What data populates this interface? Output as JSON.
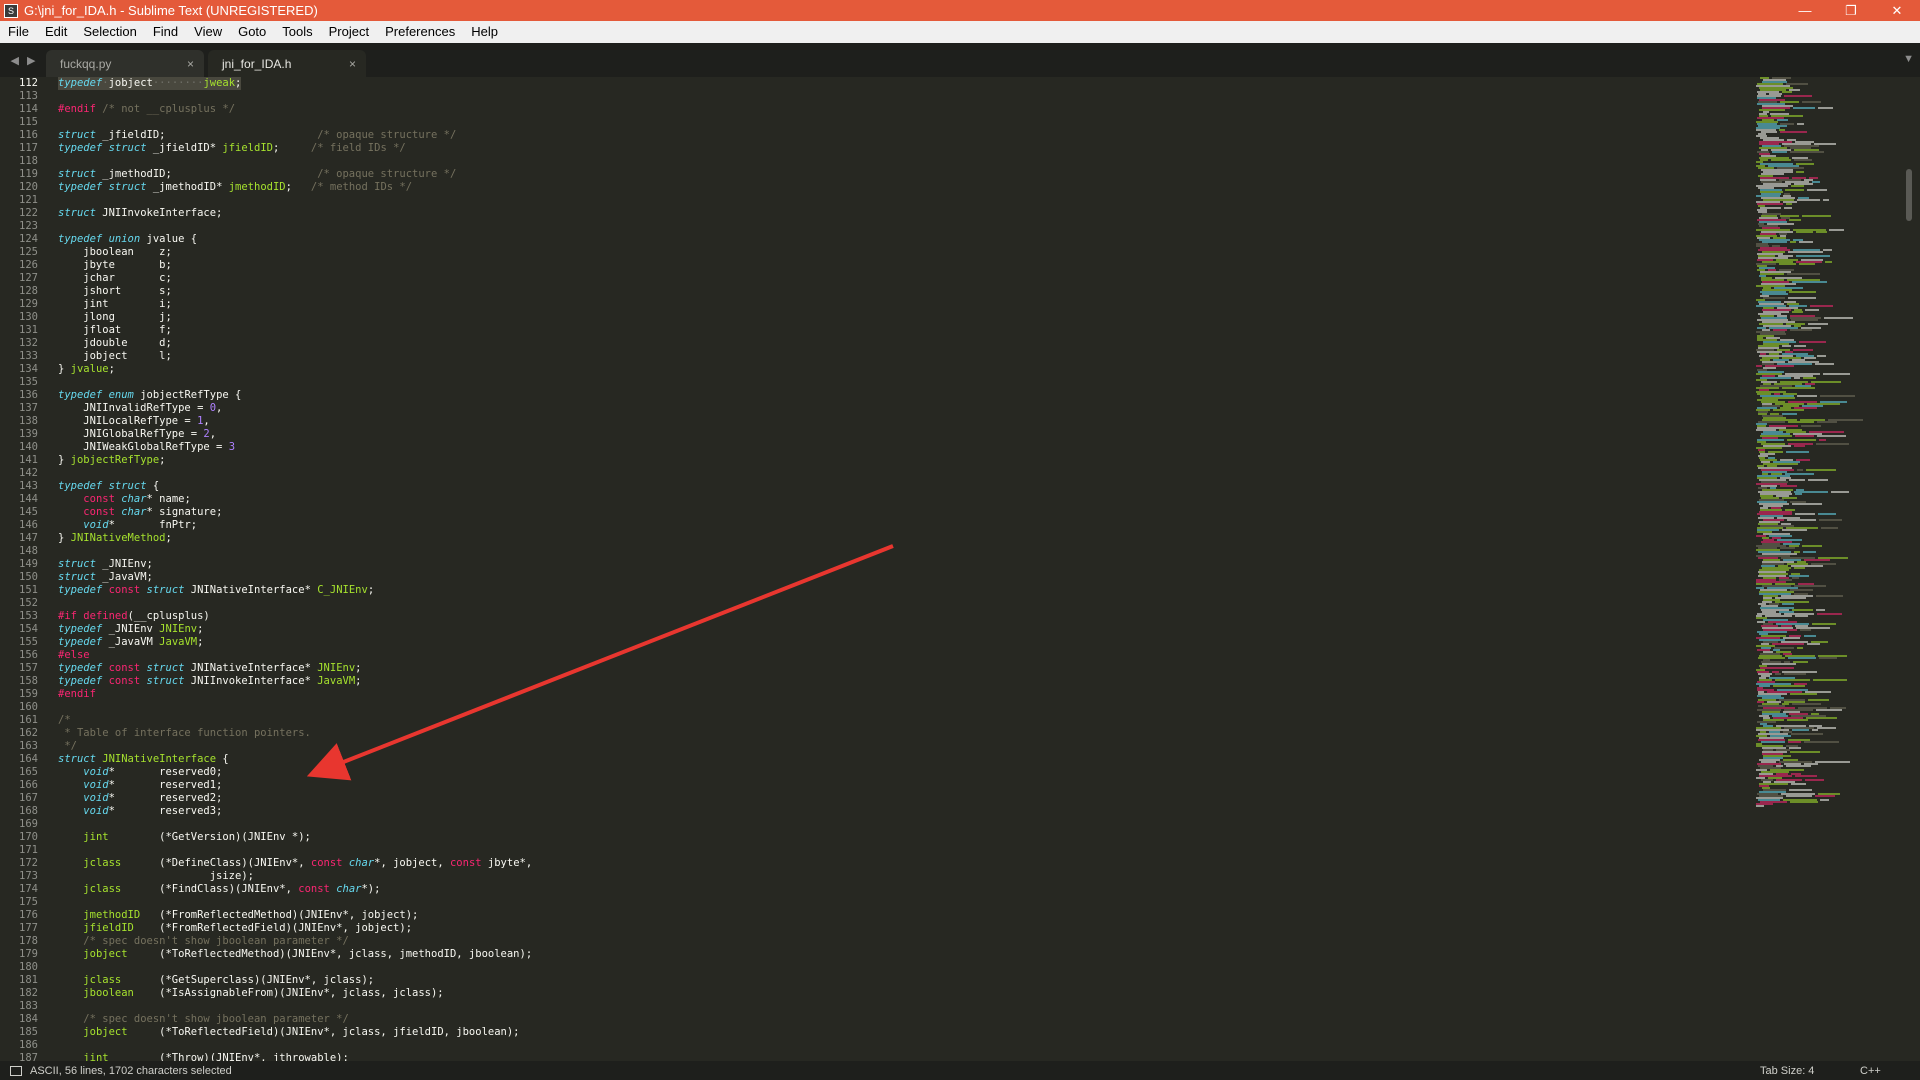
{
  "window": {
    "title": "G:\\jni_for_IDA.h - Sublime Text (UNREGISTERED)",
    "minimize": "—",
    "maximize": "❐",
    "close": "✕"
  },
  "menu": [
    "File",
    "Edit",
    "Selection",
    "Find",
    "View",
    "Goto",
    "Tools",
    "Project",
    "Preferences",
    "Help"
  ],
  "tabs": [
    {
      "label": "fuckqq.py",
      "close": "×",
      "active": false
    },
    {
      "label": "jni_for_IDA.h",
      "close": "×",
      "active": true
    }
  ],
  "nav": {
    "back": "◀",
    "forward": "▶",
    "dropdown": "▼"
  },
  "status": {
    "message": "ASCII, 56 lines, 1702 characters selected",
    "tab_size": "Tab Size: 4",
    "syntax": "C++"
  },
  "code": {
    "first_line": 112,
    "lines": [
      [
        [
          "kw",
          "typedef"
        ],
        [
          "dots",
          "·"
        ],
        [
          "t",
          "jobject"
        ],
        [
          "dots",
          "········"
        ],
        [
          "ty",
          "jweak"
        ],
        [
          "t",
          ";"
        ]
      ],
      [],
      [
        [
          "pp",
          "#endif"
        ],
        [
          "cm",
          " /* not __cplusplus */"
        ]
      ],
      [],
      [
        [
          "kw",
          "struct"
        ],
        [
          "t",
          " _jfieldID;                        "
        ],
        [
          "cm",
          "/* opaque structure */"
        ]
      ],
      [
        [
          "kw",
          "typedef"
        ],
        [
          "t",
          " "
        ],
        [
          "kw",
          "struct"
        ],
        [
          "t",
          " _jfieldID* "
        ],
        [
          "ty",
          "jfieldID"
        ],
        [
          "t",
          ";     "
        ],
        [
          "cm",
          "/* field IDs */"
        ]
      ],
      [],
      [
        [
          "kw",
          "struct"
        ],
        [
          "t",
          " _jmethodID;                       "
        ],
        [
          "cm",
          "/* opaque structure */"
        ]
      ],
      [
        [
          "kw",
          "typedef"
        ],
        [
          "t",
          " "
        ],
        [
          "kw",
          "struct"
        ],
        [
          "t",
          " _jmethodID* "
        ],
        [
          "ty",
          "jmethodID"
        ],
        [
          "t",
          ";   "
        ],
        [
          "cm",
          "/* method IDs */"
        ]
      ],
      [],
      [
        [
          "kw",
          "struct"
        ],
        [
          "t",
          " JNIInvokeInterface;"
        ]
      ],
      [],
      [
        [
          "kw",
          "typedef"
        ],
        [
          "t",
          " "
        ],
        [
          "kw",
          "union"
        ],
        [
          "t",
          " jvalue {"
        ]
      ],
      [
        [
          "t",
          "    jboolean    z;"
        ]
      ],
      [
        [
          "t",
          "    jbyte       b;"
        ]
      ],
      [
        [
          "t",
          "    jchar       c;"
        ]
      ],
      [
        [
          "t",
          "    jshort      s;"
        ]
      ],
      [
        [
          "t",
          "    jint        i;"
        ]
      ],
      [
        [
          "t",
          "    jlong       j;"
        ]
      ],
      [
        [
          "t",
          "    jfloat      f;"
        ]
      ],
      [
        [
          "t",
          "    jdouble     d;"
        ]
      ],
      [
        [
          "t",
          "    jobject     l;"
        ]
      ],
      [
        [
          "t",
          "} "
        ],
        [
          "ty",
          "jvalue"
        ],
        [
          "t",
          ";"
        ]
      ],
      [],
      [
        [
          "kw",
          "typedef"
        ],
        [
          "t",
          " "
        ],
        [
          "kw",
          "enum"
        ],
        [
          "t",
          " jobjectRefType {"
        ]
      ],
      [
        [
          "t",
          "    JNIInvalidRefType = "
        ],
        [
          "nm",
          "0"
        ],
        [
          "t",
          ","
        ]
      ],
      [
        [
          "t",
          "    JNILocalRefType = "
        ],
        [
          "nm",
          "1"
        ],
        [
          "t",
          ","
        ]
      ],
      [
        [
          "t",
          "    JNIGlobalRefType = "
        ],
        [
          "nm",
          "2"
        ],
        [
          "t",
          ","
        ]
      ],
      [
        [
          "t",
          "    JNIWeakGlobalRefType = "
        ],
        [
          "nm",
          "3"
        ]
      ],
      [
        [
          "t",
          "} "
        ],
        [
          "ty",
          "jobjectRefType"
        ],
        [
          "t",
          ";"
        ]
      ],
      [],
      [
        [
          "kw",
          "typedef"
        ],
        [
          "t",
          " "
        ],
        [
          "kw",
          "struct"
        ],
        [
          "t",
          " {"
        ]
      ],
      [
        [
          "t",
          "    "
        ],
        [
          "st",
          "const"
        ],
        [
          "t",
          " "
        ],
        [
          "kw",
          "char"
        ],
        [
          "t",
          "* name;"
        ]
      ],
      [
        [
          "t",
          "    "
        ],
        [
          "st",
          "const"
        ],
        [
          "t",
          " "
        ],
        [
          "kw",
          "char"
        ],
        [
          "t",
          "* signature;"
        ]
      ],
      [
        [
          "t",
          "    "
        ],
        [
          "kw",
          "void"
        ],
        [
          "t",
          "*       fnPtr;"
        ]
      ],
      [
        [
          "t",
          "} "
        ],
        [
          "ty",
          "JNINativeMethod"
        ],
        [
          "t",
          ";"
        ]
      ],
      [],
      [
        [
          "kw",
          "struct"
        ],
        [
          "t",
          " _JNIEnv;"
        ]
      ],
      [
        [
          "kw",
          "struct"
        ],
        [
          "t",
          " _JavaVM;"
        ]
      ],
      [
        [
          "kw",
          "typedef"
        ],
        [
          "t",
          " "
        ],
        [
          "st",
          "const"
        ],
        [
          "t",
          " "
        ],
        [
          "kw",
          "struct"
        ],
        [
          "t",
          " JNINativeInterface* "
        ],
        [
          "ty",
          "C_JNIEnv"
        ],
        [
          "t",
          ";"
        ]
      ],
      [],
      [
        [
          "pp",
          "#if"
        ],
        [
          "t",
          " "
        ],
        [
          "pp",
          "defined"
        ],
        [
          "t",
          "(__cplusplus)"
        ]
      ],
      [
        [
          "kw",
          "typedef"
        ],
        [
          "t",
          " _JNIEnv "
        ],
        [
          "ty",
          "JNIEnv"
        ],
        [
          "t",
          ";"
        ]
      ],
      [
        [
          "kw",
          "typedef"
        ],
        [
          "t",
          " _JavaVM "
        ],
        [
          "ty",
          "JavaVM"
        ],
        [
          "t",
          ";"
        ]
      ],
      [
        [
          "pp",
          "#else"
        ]
      ],
      [
        [
          "kw",
          "typedef"
        ],
        [
          "t",
          " "
        ],
        [
          "st",
          "const"
        ],
        [
          "t",
          " "
        ],
        [
          "kw",
          "struct"
        ],
        [
          "t",
          " JNINativeInterface* "
        ],
        [
          "ty",
          "JNIEnv"
        ],
        [
          "t",
          ";"
        ]
      ],
      [
        [
          "kw",
          "typedef"
        ],
        [
          "t",
          " "
        ],
        [
          "st",
          "const"
        ],
        [
          "t",
          " "
        ],
        [
          "kw",
          "struct"
        ],
        [
          "t",
          " JNIInvokeInterface* "
        ],
        [
          "ty",
          "JavaVM"
        ],
        [
          "t",
          ";"
        ]
      ],
      [
        [
          "pp",
          "#endif"
        ]
      ],
      [],
      [
        [
          "cm",
          "/*"
        ]
      ],
      [
        [
          "cm",
          " * Table of interface function pointers."
        ]
      ],
      [
        [
          "cm",
          " */"
        ]
      ],
      [
        [
          "kw",
          "struct"
        ],
        [
          "t",
          " "
        ],
        [
          "ty",
          "JNINativeInterface"
        ],
        [
          "t",
          " {"
        ]
      ],
      [
        [
          "t",
          "    "
        ],
        [
          "kw",
          "void"
        ],
        [
          "t",
          "*       reserved0;"
        ]
      ],
      [
        [
          "t",
          "    "
        ],
        [
          "kw",
          "void"
        ],
        [
          "t",
          "*       reserved1;"
        ]
      ],
      [
        [
          "t",
          "    "
        ],
        [
          "kw",
          "void"
        ],
        [
          "t",
          "*       reserved2;"
        ]
      ],
      [
        [
          "t",
          "    "
        ],
        [
          "kw",
          "void"
        ],
        [
          "t",
          "*       reserved3;"
        ]
      ],
      [],
      [
        [
          "t",
          "    "
        ],
        [
          "ty",
          "jint"
        ],
        [
          "t",
          "        (*GetVersion)(JNIEnv *);"
        ]
      ],
      [],
      [
        [
          "t",
          "    "
        ],
        [
          "ty",
          "jclass"
        ],
        [
          "t",
          "      (*DefineClass)(JNIEnv*, "
        ],
        [
          "st",
          "const"
        ],
        [
          "t",
          " "
        ],
        [
          "kw",
          "char"
        ],
        [
          "t",
          "*, jobject, "
        ],
        [
          "st",
          "const"
        ],
        [
          "t",
          " jbyte*,"
        ]
      ],
      [
        [
          "t",
          "                        jsize);"
        ]
      ],
      [
        [
          "t",
          "    "
        ],
        [
          "ty",
          "jclass"
        ],
        [
          "t",
          "      (*FindClass)(JNIEnv*, "
        ],
        [
          "st",
          "const"
        ],
        [
          "t",
          " "
        ],
        [
          "kw",
          "char"
        ],
        [
          "t",
          "*);"
        ]
      ],
      [],
      [
        [
          "t",
          "    "
        ],
        [
          "ty",
          "jmethodID"
        ],
        [
          "t",
          "   (*FromReflectedMethod)(JNIEnv*, jobject);"
        ]
      ],
      [
        [
          "t",
          "    "
        ],
        [
          "ty",
          "jfieldID"
        ],
        [
          "t",
          "    (*FromReflectedField)(JNIEnv*, jobject);"
        ]
      ],
      [
        [
          "t",
          "    "
        ],
        [
          "cm",
          "/* spec doesn't show jboolean parameter */"
        ]
      ],
      [
        [
          "t",
          "    "
        ],
        [
          "ty",
          "jobject"
        ],
        [
          "t",
          "     (*ToReflectedMethod)(JNIEnv*, jclass, jmethodID, jboolean);"
        ]
      ],
      [],
      [
        [
          "t",
          "    "
        ],
        [
          "ty",
          "jclass"
        ],
        [
          "t",
          "      (*GetSuperclass)(JNIEnv*, jclass);"
        ]
      ],
      [
        [
          "t",
          "    "
        ],
        [
          "ty",
          "jboolean"
        ],
        [
          "t",
          "    (*IsAssignableFrom)(JNIEnv*, jclass, jclass);"
        ]
      ],
      [],
      [
        [
          "t",
          "    "
        ],
        [
          "cm",
          "/* spec doesn't show jboolean parameter */"
        ]
      ],
      [
        [
          "t",
          "    "
        ],
        [
          "ty",
          "jobject"
        ],
        [
          "t",
          "     (*ToReflectedField)(JNIEnv*, jclass, jfieldID, jboolean);"
        ]
      ],
      [],
      [
        [
          "t",
          "    "
        ],
        [
          "ty",
          "jint"
        ],
        [
          "t",
          "        (*Throw)(JNIEnv*, jthrowable);"
        ]
      ]
    ]
  },
  "colors": {
    "titlebar": "#e45a3a",
    "editor_bg": "#272822",
    "selection": "#49483e",
    "annotation_arrow": "#e8362f"
  }
}
